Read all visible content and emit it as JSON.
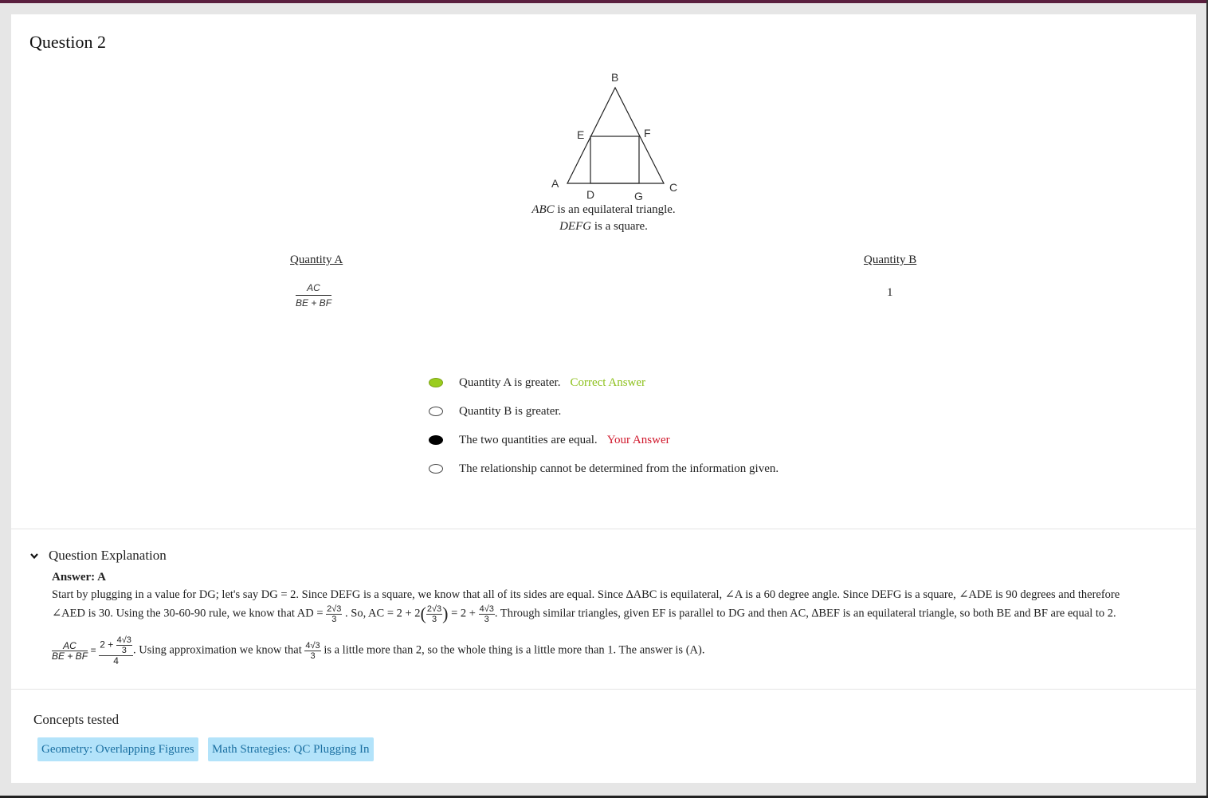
{
  "question": {
    "title": "Question 2",
    "figure_labels": [
      "B",
      "E",
      "F",
      "A",
      "D",
      "G",
      "C"
    ],
    "caption_line1_var": "ABC",
    "caption_line1_text": " is an equilateral triangle.",
    "caption_line2_var": "DEFG",
    "caption_line2_text": " is a square.",
    "quantity_a_label": "Quantity A",
    "quantity_a_num": "AC",
    "quantity_a_den": "BE + BF",
    "quantity_b_label": "Quantity B",
    "quantity_b_value": "1"
  },
  "choices": [
    {
      "label": "Quantity A is greater.",
      "tag": "Correct Answer",
      "state": "correct"
    },
    {
      "label": "Quantity B is greater.",
      "tag": "",
      "state": "none"
    },
    {
      "label": "The two quantities are equal.",
      "tag": "Your Answer",
      "state": "selected"
    },
    {
      "label": "The relationship cannot be determined from the information given.",
      "tag": "",
      "state": "none"
    }
  ],
  "explanation": {
    "heading": "Question Explanation",
    "answer": "Answer: A",
    "line1": "Start by plugging in a value for DG; let's say DG = 2. Since DEFG is a square, we know that all of its sides are equal. Since ∆ABC is equilateral, ∠A is a 60 degree angle. Since DEFG is a square, ∠ADE is 90 degrees and therefore",
    "line2_a": "∠AED is 30. Using the 30-60-90 rule, we know that AD = ",
    "line2_frac1_num": "2√3",
    "line2_frac1_den": "3",
    "line2_b": " . So, AC = 2 + 2",
    "line2_paren_num": "2√3",
    "line2_paren_den": "3",
    "line2_c": " = 2 + ",
    "line2_frac2_num": "4√3",
    "line2_frac2_den": "3",
    "line2_d": ". Through similar triangles, given EF is parallel to DG and then AC, ∆BEF is an equilateral triangle, so both BE and BF are equal to 2.",
    "line3_lhs_num": "AC",
    "line3_lhs_den": "BE + BF",
    "line3_eq": "=",
    "line3_rhs_num_prefix": "2 + ",
    "line3_rhs_inner_num": "4√3",
    "line3_rhs_inner_den": "3",
    "line3_rhs_den": "4",
    "line3_a": ". Using approximation we know that ",
    "line3_frac_num": "4√3",
    "line3_frac_den": "3",
    "line3_b": " is a little more than 2, so the whole thing is a little more than 1. The answer is (A)."
  },
  "concepts": {
    "title": "Concepts tested",
    "tags": [
      "Geometry: Overlapping Figures",
      "Math Strategies: QC Plugging In"
    ]
  },
  "colors": {
    "correct": "#8cc01a",
    "your_answer": "#d0182c",
    "tag_bg": "#b3e3fa",
    "tag_text": "#1a6fa1"
  },
  "icons": {
    "expand": "chevron-down-icon"
  }
}
